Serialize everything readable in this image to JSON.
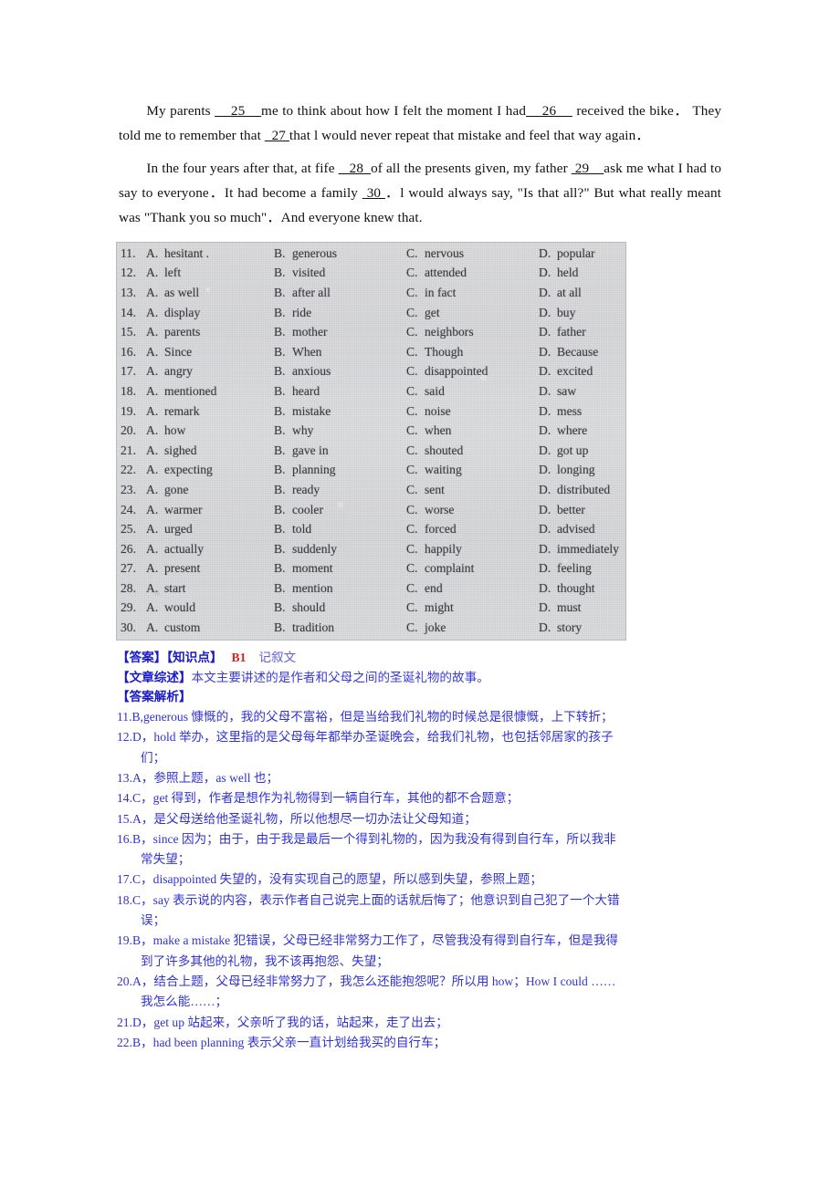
{
  "passage": {
    "paragraphs": [
      [
        {
          "t": "text",
          "v": "My parents "
        },
        {
          "t": "blank",
          "v": "    25    "
        },
        {
          "t": "text",
          "v": "me to think about how I felt the moment I had"
        },
        {
          "t": "blank",
          "v": "    26    "
        },
        {
          "t": "text",
          "v": " received the bike．  They told me to remember that "
        },
        {
          "t": "blank",
          "v": "  27 "
        },
        {
          "t": "text",
          "v": "that l would never repeat that mistake and feel that way again．"
        }
      ],
      [
        {
          "t": "text",
          "v": "In the four years after that, at fife "
        },
        {
          "t": "blank",
          "v": "   28  "
        },
        {
          "t": "text",
          "v": "of all the presents given, my father "
        },
        {
          "t": "blank",
          "v": " 29    "
        },
        {
          "t": "text",
          "v": "ask me what I had to say to everyone．It had become a family "
        },
        {
          "t": "blank",
          "v": " 30 "
        },
        {
          "t": "text",
          "v": "．l would always say, \"Is that all?\" But what really meant was \"Thank you so much\"．And everyone knew that."
        }
      ]
    ]
  },
  "options_table": {
    "rows": [
      {
        "num": "11.",
        "a": "hesitant   .",
        "b": "generous",
        "c": "nervous",
        "d": "popular"
      },
      {
        "num": "12.",
        "a": "left",
        "b": "visited",
        "c": "attended",
        "d": "held"
      },
      {
        "num": "13.",
        "a": "as well",
        "b": "after all",
        "c": "in fact",
        "d": "at all"
      },
      {
        "num": "14.",
        "a": "display",
        "b": "ride",
        "c": "get",
        "d": "buy"
      },
      {
        "num": "15.",
        "a": "parents",
        "b": "mother",
        "c": "neighbors",
        "d": "father"
      },
      {
        "num": "16.",
        "a": "Since",
        "b": "When",
        "c": "Though",
        "d": "Because"
      },
      {
        "num": "17.",
        "a": "angry",
        "b": "anxious",
        "c": "disappointed",
        "d": "excited"
      },
      {
        "num": "18.",
        "a": "mentioned",
        "b": "heard",
        "c": "said",
        "d": "saw"
      },
      {
        "num": "19.",
        "a": "remark",
        "b": "mistake",
        "c": "noise",
        "d": "mess"
      },
      {
        "num": "20.",
        "a": "how",
        "b": "why",
        "c": "when",
        "d": "where"
      },
      {
        "num": "21.",
        "a": "sighed",
        "b": "gave in",
        "c": "shouted",
        "d": "got up"
      },
      {
        "num": "22.",
        "a": "expecting",
        "b": "planning",
        "c": "waiting",
        "d": "longing"
      },
      {
        "num": "23.",
        "a": "gone",
        "b": "ready",
        "c": "sent",
        "d": "distributed"
      },
      {
        "num": "24.",
        "a": "warmer",
        "b": "cooler",
        "c": "worse",
        "d": "better"
      },
      {
        "num": "25.",
        "a": "urged",
        "b": "told",
        "c": "forced",
        "d": "advised"
      },
      {
        "num": "26.",
        "a": "actually",
        "b": "suddenly",
        "c": "happily",
        "d": "immediately"
      },
      {
        "num": "27.",
        "a": "present",
        "b": "moment",
        "c": "complaint",
        "d": "feeling"
      },
      {
        "num": "28.",
        "a": "start",
        "b": "mention",
        "c": "end",
        "d": "thought"
      },
      {
        "num": "29.",
        "a": "would",
        "b": "should",
        "c": "might",
        "d": "must"
      },
      {
        "num": "30.",
        "a": "custom",
        "b": "tradition",
        "c": "joke",
        "d": "story"
      }
    ],
    "letters": {
      "a": "A.",
      "b": "B.",
      "c": "C.",
      "d": "D."
    }
  },
  "answer_section": {
    "line1": {
      "tag": "【答案】【知识点】",
      "code": "B1",
      "genre": "记叙文"
    },
    "line2": {
      "tag": "【文章综述】",
      "desc": "本文主要讲述的是作者和父母之间的圣诞礼物的故事。"
    },
    "line3": {
      "tag": "【答案解析】"
    },
    "items": [
      {
        "main": "11.B,generous 慷慨的，我的父母不富裕，但是当给我们礼物的时候总是很慷慨，上下转折；",
        "cont": ""
      },
      {
        "main": "12.D，hold 举办，这里指的是父母每年都举办圣诞晚会，给我们礼物，也包括邻居家的孩子",
        "cont": "们；"
      },
      {
        "main": "13.A，参照上题，as well 也；",
        "cont": ""
      },
      {
        "main": "14.C，get 得到，作者是想作为礼物得到一辆自行车，其他的都不合题意；",
        "cont": ""
      },
      {
        "main": "15.A，是父母送给他圣诞礼物，所以他想尽一切办法让父母知道；",
        "cont": ""
      },
      {
        "main": "16.B，since 因为；由于，由于我是最后一个得到礼物的，因为我没有得到自行车，所以我非",
        "cont": "常失望；"
      },
      {
        "main": "17.C，disappointed 失望的，没有实现自己的愿望，所以感到失望，参照上题；",
        "cont": ""
      },
      {
        "main": "18.C，say 表示说的内容，表示作者自己说完上面的话就后悔了；他意识到自己犯了一个大错",
        "cont": "误；"
      },
      {
        "main": "19.B，make a mistake 犯错误，父母已经非常努力工作了，尽管我没有得到自行车，但是我得",
        "cont": "到了许多其他的礼物，我不该再抱怨、失望；"
      },
      {
        "main": "20.A，结合上题，父母已经非常努力了，我怎么还能抱怨呢？所以用 how；How I could ……",
        "cont": "我怎么能……；"
      },
      {
        "main": "21.D，get up 站起来，父亲听了我的话，站起来，走了出去；",
        "cont": ""
      },
      {
        "main": "22.B，had been planning 表示父亲一直计划给我买的自行车；",
        "cont": ""
      }
    ]
  }
}
